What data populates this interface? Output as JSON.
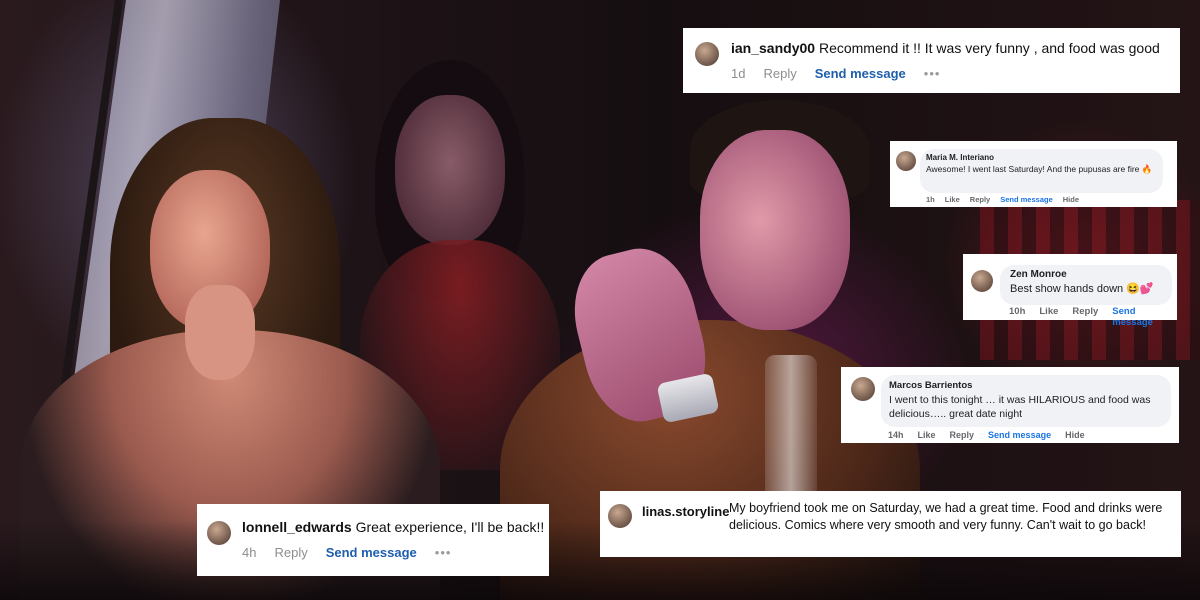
{
  "comments": {
    "ian": {
      "username": "ian_sandy00",
      "text": "Recommend it !! It was very funny , and food was good",
      "time": "1d",
      "reply": "Reply",
      "send": "Send message",
      "more": "•••"
    },
    "maria": {
      "name": "Maria M. Interiano",
      "text": "Awesome! I went last Saturday! And the pupusas are fire 🔥",
      "time": "1h",
      "like": "Like",
      "reply": "Reply",
      "send": "Send message",
      "hide": "Hide"
    },
    "zen": {
      "name": "Zen Monroe",
      "text": "Best show hands down 😆💕",
      "time": "10h",
      "like": "Like",
      "reply": "Reply",
      "send": "Send message"
    },
    "marcos": {
      "name": "Marcos Barrientos",
      "text": "I went to this tonight … it was HILARIOUS and food was delicious….. great date night",
      "time": "14h",
      "like": "Like",
      "reply": "Reply",
      "send": "Send message",
      "hide": "Hide"
    },
    "lonnell": {
      "username": "lonnell_edwards",
      "text": "Great experience, I'll be back!!",
      "time": "4h",
      "reply": "Reply",
      "send": "Send message",
      "more": "•••"
    },
    "linas": {
      "username": "linas.storyline",
      "text": "My boyfriend took me on Saturday, we had a great time. Food and drinks were delicious. Comics where very smooth and very funny. Can't wait to go back!"
    }
  },
  "colors": {
    "link_blue_ig": "#1f5fae",
    "link_blue_fb": "#1b74e4",
    "meta_gray": "#8e8e8e",
    "bubble_gray": "#f0f2f5"
  }
}
